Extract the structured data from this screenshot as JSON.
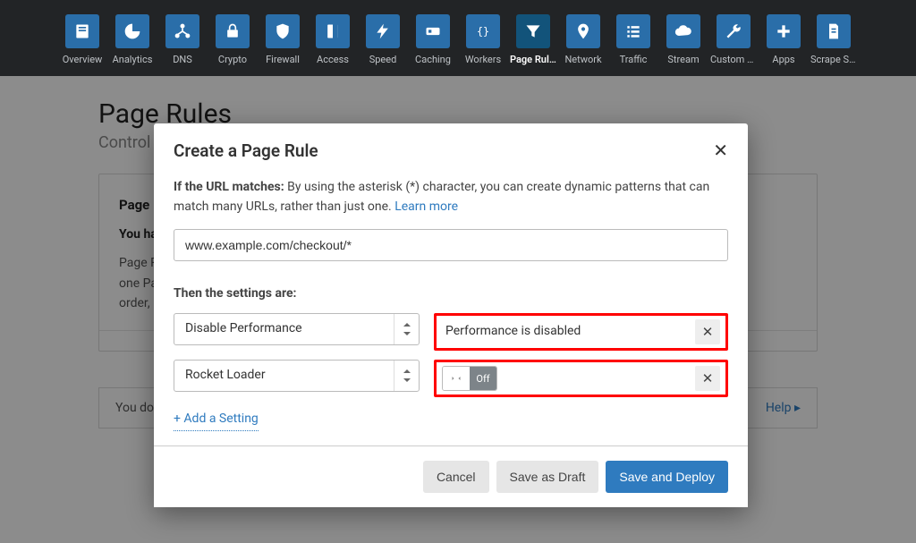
{
  "nav": {
    "items": [
      {
        "key": "overview",
        "label": "Overview"
      },
      {
        "key": "analytics",
        "label": "Analytics"
      },
      {
        "key": "dns",
        "label": "DNS"
      },
      {
        "key": "crypto",
        "label": "Crypto"
      },
      {
        "key": "firewall",
        "label": "Firewall"
      },
      {
        "key": "access",
        "label": "Access"
      },
      {
        "key": "speed",
        "label": "Speed"
      },
      {
        "key": "caching",
        "label": "Caching"
      },
      {
        "key": "workers",
        "label": "Workers"
      },
      {
        "key": "pagerules",
        "label": "Page Rules"
      },
      {
        "key": "network",
        "label": "Network"
      },
      {
        "key": "traffic",
        "label": "Traffic"
      },
      {
        "key": "stream",
        "label": "Stream"
      },
      {
        "key": "customp",
        "label": "Custom P…"
      },
      {
        "key": "apps",
        "label": "Apps"
      },
      {
        "key": "scrape",
        "label": "Scrape Sh…"
      }
    ],
    "active": "pagerules"
  },
  "page": {
    "title": "Page Rules",
    "subtitle": "Control",
    "card_heading": "Page",
    "card_strong": "You ha",
    "card_body_line1": "Page R",
    "card_body_line2": "one Pa",
    "card_body_line3": "order,",
    "below_text": "You do n",
    "help_label": "Help ▸"
  },
  "modal": {
    "title": "Create a Page Rule",
    "desc_bold": "If the URL matches:",
    "desc_text": " By using the asterisk (*) character, you can create dynamic patterns that can match many URLs, rather than just one. ",
    "learn_more": "Learn more",
    "url_value": "www.example.com/checkout/*",
    "then_label": "Then the settings are:",
    "settings": [
      {
        "name": "Disable Performance",
        "value_text": "Performance is disabled",
        "type": "text"
      },
      {
        "name": "Rocket Loader",
        "value_text": "Off",
        "type": "toggle"
      }
    ],
    "add_setting": "+ Add a Setting",
    "buttons": {
      "cancel": "Cancel",
      "draft": "Save as Draft",
      "deploy": "Save and Deploy"
    }
  }
}
